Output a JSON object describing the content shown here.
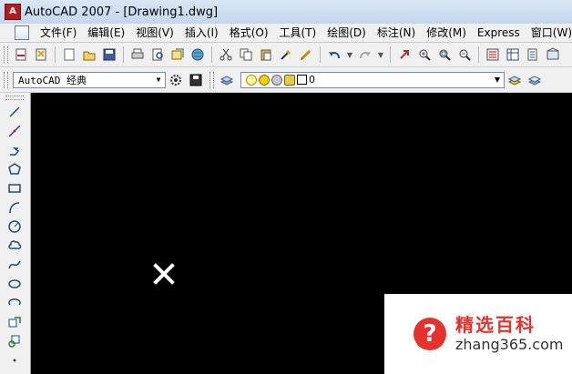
{
  "window": {
    "title": "AutoCAD 2007 - [Drawing1.dwg]"
  },
  "menu": {
    "items": [
      {
        "label": "文件(F)"
      },
      {
        "label": "编辑(E)"
      },
      {
        "label": "视图(V)"
      },
      {
        "label": "插入(I)"
      },
      {
        "label": "格式(O)"
      },
      {
        "label": "工具(T)"
      },
      {
        "label": "绘图(D)"
      },
      {
        "label": "标注(N)"
      },
      {
        "label": "修改(M)"
      },
      {
        "label": "Express"
      },
      {
        "label": "窗口(W)"
      }
    ]
  },
  "toolbar2": {
    "workspace": {
      "value": "AutoCAD 经典"
    },
    "layer": {
      "value": "0"
    }
  },
  "watermark": {
    "text_cn": "精选百科",
    "text_en": "zhang365.com",
    "logo_glyph": "?"
  },
  "colors": {
    "canvas": "#000000",
    "accent_red": "#e5322d",
    "chrome": "#f0f0f0"
  }
}
